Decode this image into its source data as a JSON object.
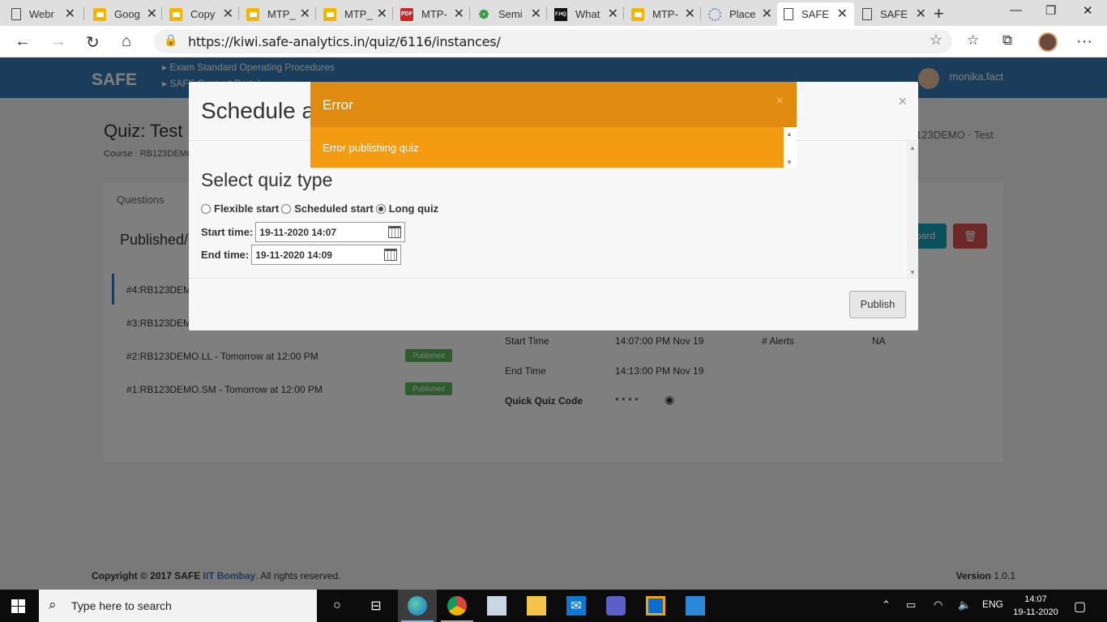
{
  "browser": {
    "tabs": [
      {
        "title": "Webr",
        "icon": "doc-icon"
      },
      {
        "title": "Goog",
        "icon": "slides-icon"
      },
      {
        "title": "Copy",
        "icon": "slides-icon"
      },
      {
        "title": "MTP_",
        "icon": "slides-icon"
      },
      {
        "title": "MTP_",
        "icon": "slides-icon"
      },
      {
        "title": "MTP-",
        "icon": "pdf-icon"
      },
      {
        "title": "Semi",
        "icon": "semi-icon"
      },
      {
        "title": "What",
        "icon": "what-icon"
      },
      {
        "title": "MTP-",
        "icon": "slides-icon"
      },
      {
        "title": "Place",
        "icon": "place-icon"
      },
      {
        "title": "SAFE",
        "icon": "doc-icon",
        "active": true
      },
      {
        "title": "SAFE",
        "icon": "doc-icon"
      }
    ],
    "url": "https://kiwi.safe-analytics.in/quiz/6116/instances/"
  },
  "app": {
    "brand": "SAFE",
    "menu_items": [
      "▸ Exam Standard Operating Procedures",
      "▸ SAFE Support Portal"
    ],
    "user": "monika.fact",
    "quiz_title": "Quiz: Test",
    "course": "Course : RB123DEMO",
    "breadcrumb": "123DEMO  ·  Test",
    "questions_tab": "Questions",
    "published_header": "Published/U",
    "instances": [
      {
        "label": "#4:RB123DEMO",
        "badge": ""
      },
      {
        "label": "#3:RB123DEMO",
        "badge": ""
      },
      {
        "label": "#2:RB123DEMO.LL - Tomorrow at 12:00 PM",
        "badge": "Published"
      },
      {
        "label": "#1:RB123DEMO.SM - Tomorrow at 12:00 PM",
        "badge": "Published"
      }
    ],
    "details": {
      "start_label": "Start Time",
      "start_value": "14:07:00 PM Nov 19",
      "alerts_label": "# Alerts",
      "alerts_value": "NA",
      "end_label": "End Time",
      "end_value": "14:13:00 PM Nov 19",
      "code_label": "Quick Quiz Code",
      "code_value": "* * * *"
    },
    "board_button": "oard",
    "footer": {
      "copyright_prefix": "Copyright © 2017 SAFE ",
      "copyright_link": "IIT Bombay",
      "copyright_suffix": ". All rights reserved.",
      "version": "Version 1.0.1"
    }
  },
  "schedule_modal": {
    "title": "Schedule a",
    "close": "×",
    "section_title": "Select quiz type",
    "options": [
      "Flexible start",
      "Scheduled start",
      "Long quiz"
    ],
    "selected_option": "Long quiz",
    "start_label": "Start time:",
    "start_value": "19-11-2020 14:07",
    "end_label": "End time:",
    "end_value": "19-11-2020 14:09",
    "publish": "Publish"
  },
  "error_modal": {
    "title": "Error",
    "close": "×",
    "message": "Error publishing quiz",
    "header_color": "#de8b10",
    "body_color": "#f39c12"
  },
  "taskbar": {
    "search_placeholder": "Type here to search",
    "language": "ENG",
    "time": "14:07",
    "date": "19-11-2020"
  }
}
